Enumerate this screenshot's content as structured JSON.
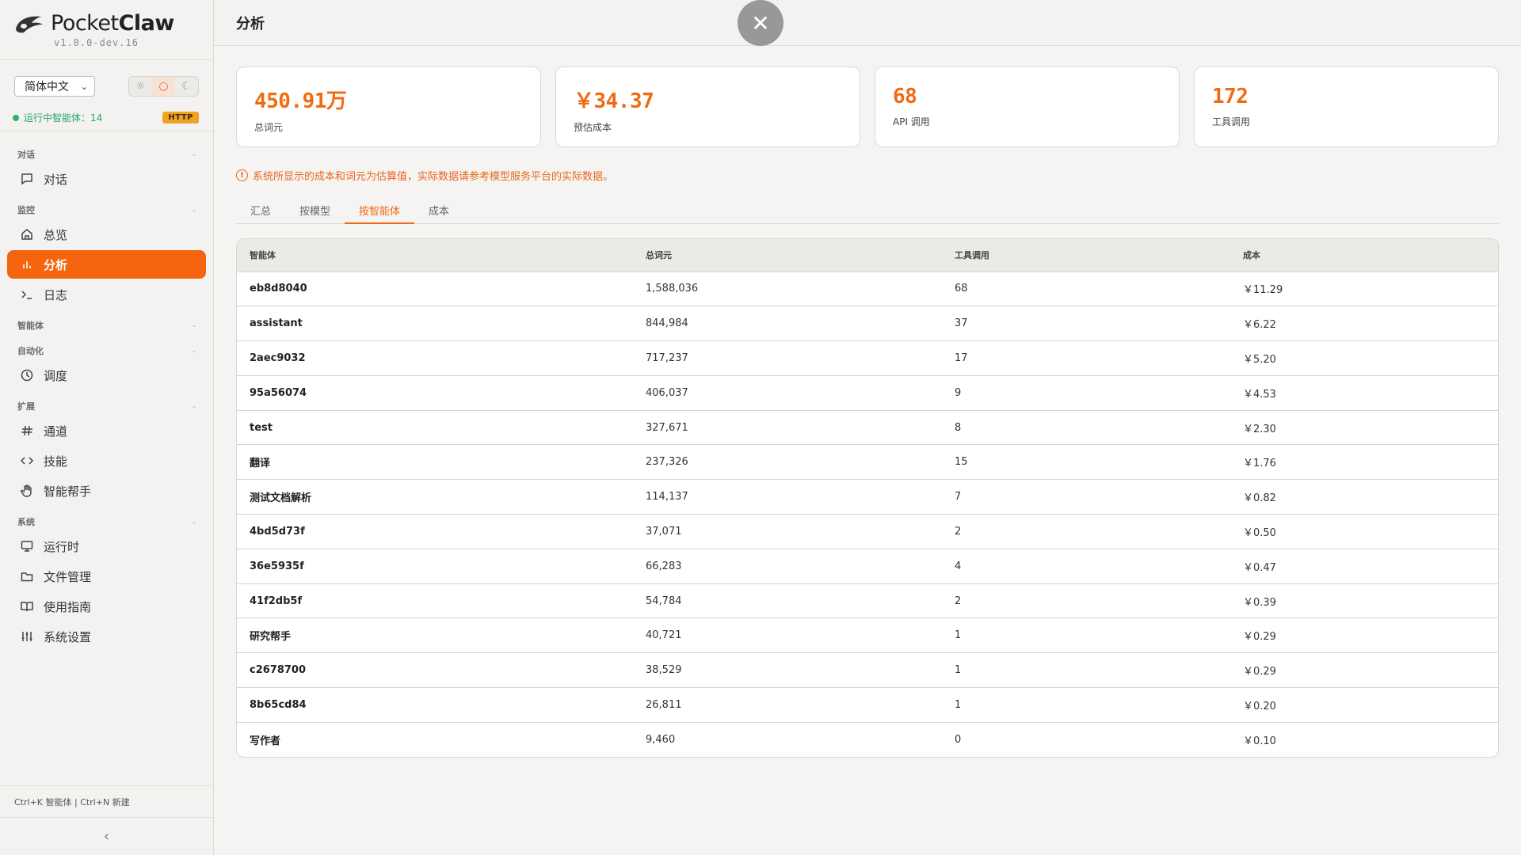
{
  "app": {
    "brand_light": "Pocket",
    "brand_bold": "Claw",
    "version": "v1.0.0-dev.16",
    "language": "简体中文",
    "status_text": "运行中智能体：14",
    "http_badge": "HTTP",
    "shortcut_hint": "Ctrl+K 智能体 | Ctrl+N 新建"
  },
  "nav": {
    "sections": {
      "chat": "对话",
      "monitor": "监控",
      "agents": "智能体",
      "automation": "自动化",
      "extensions": "扩展",
      "system": "系统"
    },
    "items": {
      "chat": "对话",
      "overview": "总览",
      "analytics": "分析",
      "logs": "日志",
      "schedule": "调度",
      "channels": "通道",
      "skills": "技能",
      "helper": "智能帮手",
      "runtime": "运行时",
      "files": "文件管理",
      "guide": "使用指南",
      "settings": "系统设置"
    }
  },
  "page": {
    "title": "分析",
    "notice": "系统所显示的成本和词元为估算值，实际数据请参考模型服务平台的实际数据。"
  },
  "cards": [
    {
      "value": "450.91万",
      "label": "总词元"
    },
    {
      "value": "￥34.37",
      "label": "预估成本"
    },
    {
      "value": "68",
      "label": "API 调用"
    },
    {
      "value": "172",
      "label": "工具调用"
    }
  ],
  "tabs": [
    "汇总",
    "按模型",
    "按智能体",
    "成本"
  ],
  "active_tab": 2,
  "table": {
    "headers": [
      "智能体",
      "总词元",
      "工具调用",
      "成本"
    ],
    "rows": [
      [
        "eb8d8040",
        "1,588,036",
        "68",
        "￥11.29"
      ],
      [
        "assistant",
        "844,984",
        "37",
        "￥6.22"
      ],
      [
        "2aec9032",
        "717,237",
        "17",
        "￥5.20"
      ],
      [
        "95a56074",
        "406,037",
        "9",
        "￥4.53"
      ],
      [
        "test",
        "327,671",
        "8",
        "￥2.30"
      ],
      [
        "翻译",
        "237,326",
        "15",
        "￥1.76"
      ],
      [
        "测试文档解析",
        "114,137",
        "7",
        "￥0.82"
      ],
      [
        "4bd5d73f",
        "37,071",
        "2",
        "￥0.50"
      ],
      [
        "36e5935f",
        "66,283",
        "4",
        "￥0.47"
      ],
      [
        "41f2db5f",
        "54,784",
        "2",
        "￥0.39"
      ],
      [
        "研究帮手",
        "40,721",
        "1",
        "￥0.29"
      ],
      [
        "c2678700",
        "38,529",
        "1",
        "￥0.29"
      ],
      [
        "8b65cd84",
        "26,811",
        "1",
        "￥0.20"
      ],
      [
        "写作者",
        "9,460",
        "0",
        "￥0.10"
      ]
    ]
  },
  "colors": {
    "accent": "#f5640f",
    "status_green": "#29b567",
    "badge": "#f0a126"
  }
}
